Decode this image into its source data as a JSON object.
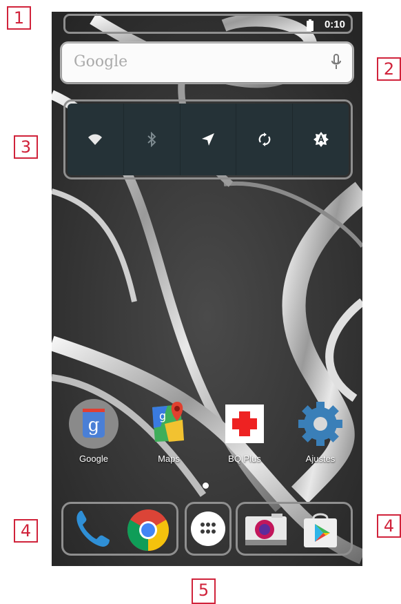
{
  "status_bar": {
    "time": "0:10"
  },
  "search": {
    "logo": "Google",
    "mic_icon": "mic-icon"
  },
  "quick_settings": [
    {
      "name": "wifi",
      "icon": "wifi-icon"
    },
    {
      "name": "bluetooth",
      "icon": "bluetooth-icon"
    },
    {
      "name": "location",
      "icon": "location-icon"
    },
    {
      "name": "sync",
      "icon": "sync-icon"
    },
    {
      "name": "auto-brightness",
      "icon": "auto-brightness-icon"
    }
  ],
  "apps": [
    {
      "label": "Google",
      "icon": "google-folder-icon"
    },
    {
      "label": "Maps",
      "icon": "maps-icon"
    },
    {
      "label": "BQ Plus",
      "icon": "bq-plus-icon"
    },
    {
      "label": "Ajustes",
      "icon": "settings-gear-icon"
    }
  ],
  "dock": [
    {
      "name": "phone",
      "icon": "phone-icon"
    },
    {
      "name": "chrome",
      "icon": "chrome-icon"
    },
    {
      "name": "app-drawer",
      "icon": "app-drawer-icon"
    },
    {
      "name": "camera",
      "icon": "camera-icon"
    },
    {
      "name": "play-store",
      "icon": "play-store-icon"
    }
  ],
  "callouts": [
    "1",
    "2",
    "3",
    "4",
    "4",
    "5"
  ],
  "colors": {
    "callout": "#d0223a",
    "quick_settings_bg": "#253237",
    "wallpaper": "#3b3b3b"
  }
}
